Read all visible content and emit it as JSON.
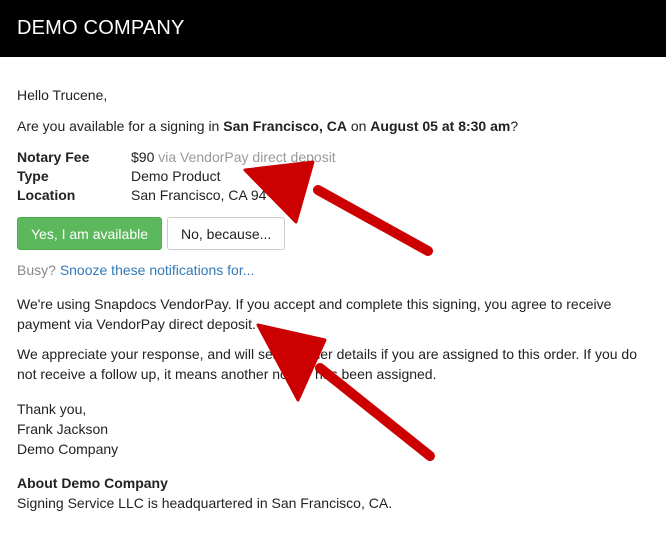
{
  "header": {
    "brand": "DEMO COMPANY"
  },
  "email": {
    "greeting": "Hello Trucene,",
    "question": {
      "prefix": "Are you available for a signing in ",
      "city": "San Francisco, CA",
      "mid": " on ",
      "date": "August 05 at 8:30 am",
      "suffix": "?"
    },
    "details": {
      "fee_label": "Notary Fee",
      "fee_amount": "$90",
      "fee_method": " via VendorPay direct deposit",
      "type_label": "Type",
      "type_value": "Demo Product",
      "location_label": "Location",
      "location_value": "San Francisco, CA 94"
    },
    "actions": {
      "yes_label": "Yes, I am available",
      "no_label": "No, because..."
    },
    "busy": {
      "prefix": "Busy? ",
      "link": "Snooze these notifications for..."
    },
    "vendorpay_text": "We're using Snapdocs VendorPay. If you accept and complete this signing, you agree to receive payment via VendorPay direct deposit.",
    "appreciate_text": "We appreciate your response, and will send further details if you are assigned to this order. If you do not receive a follow up, it means another notary has been assigned.",
    "signoff": {
      "thanks": "Thank you,",
      "name": "Frank Jackson",
      "company": "Demo Company"
    },
    "about": {
      "title": "About Demo Company",
      "text": "Signing Service LLC is headquartered in San Francisco, CA."
    }
  },
  "annotation_color": "#cc0000"
}
